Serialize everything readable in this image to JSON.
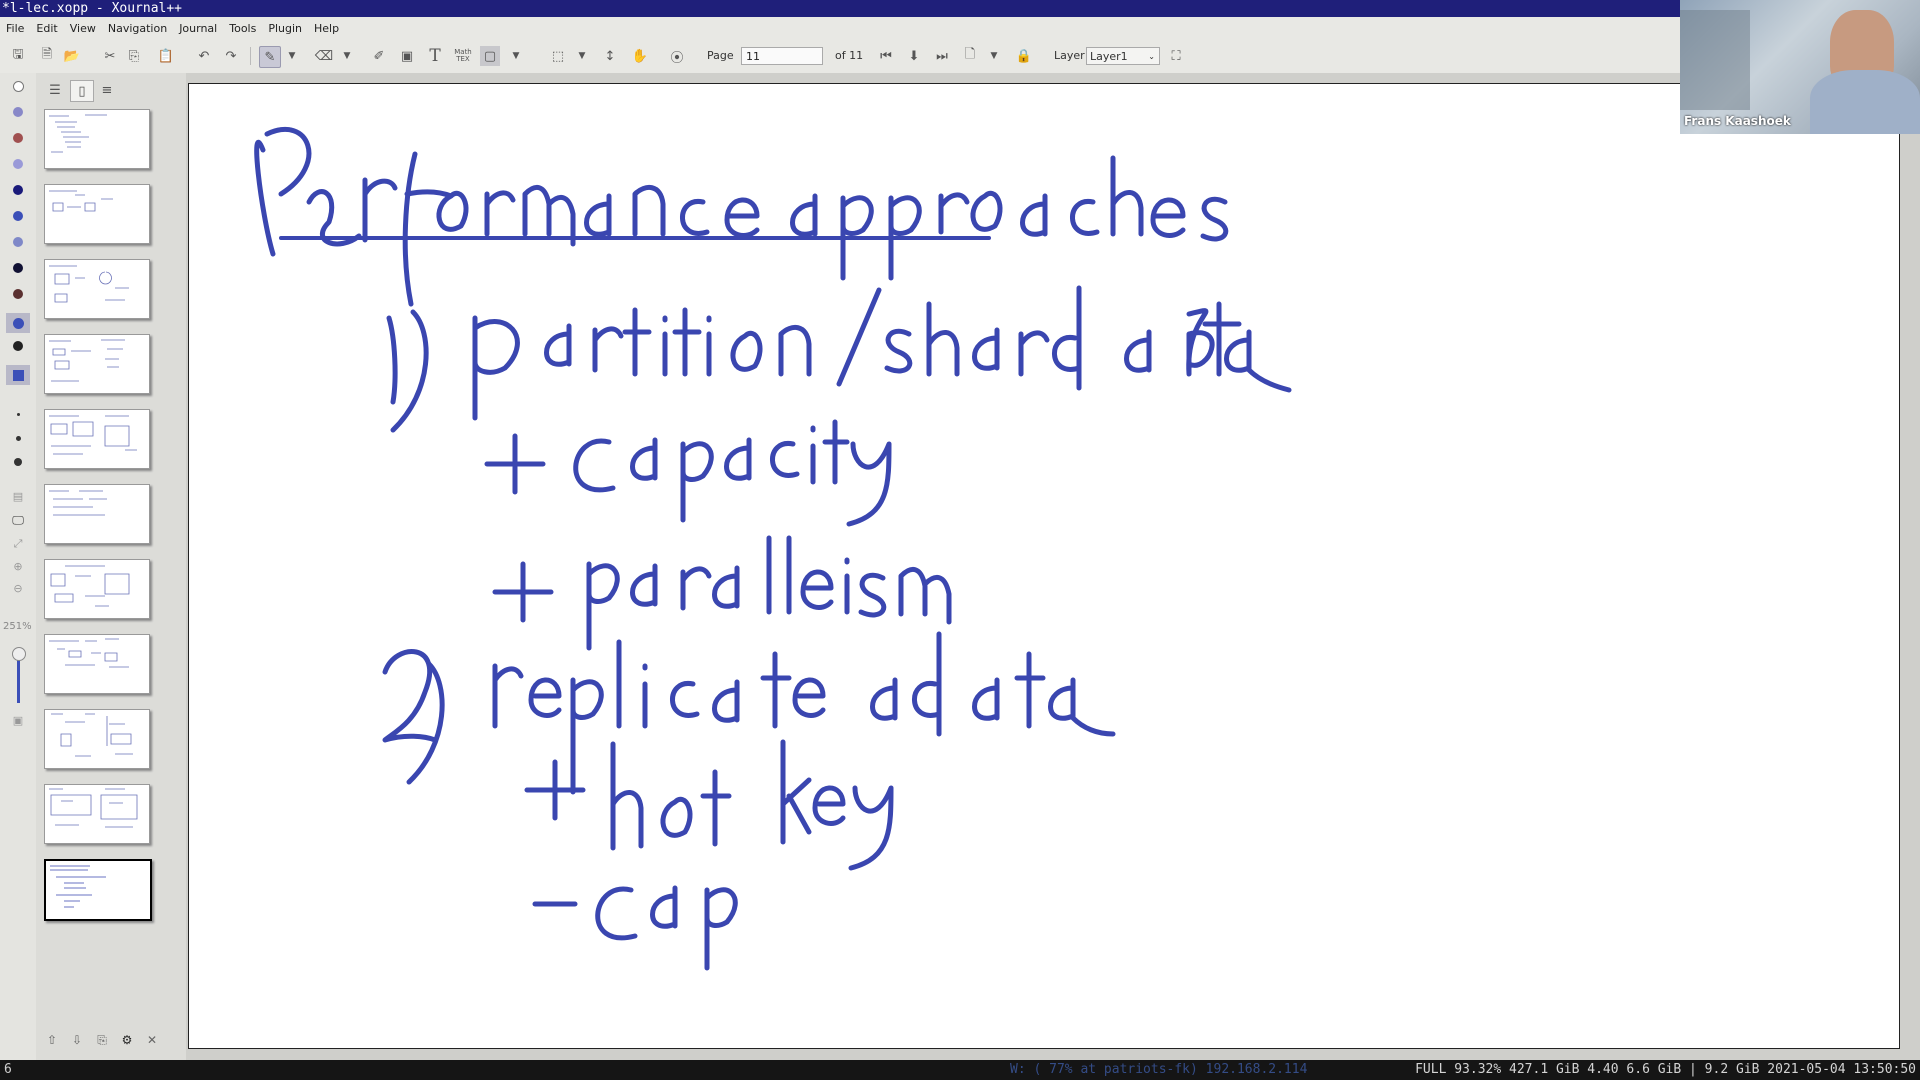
{
  "window": {
    "title": "*l-lec.xopp - Xournal++"
  },
  "menubar": {
    "items": [
      "File",
      "Edit",
      "View",
      "Navigation",
      "Journal",
      "Tools",
      "Plugin",
      "Help"
    ]
  },
  "toolbar": {
    "page_label": "Page",
    "page_value": "11",
    "page_of": "of 11",
    "layer_label": "Layer",
    "layer_value": "Layer1",
    "icons": [
      "save-icon",
      "new-page-icon",
      "open-icon",
      "cut-icon",
      "copy-icon",
      "paste-icon",
      "undo-icon",
      "redo-icon",
      "pen-icon",
      "eraser-icon",
      "highlighter-icon",
      "image-icon",
      "text-icon",
      "math-tex-icon",
      "select-icon",
      "hand-icon",
      "zoom-icon",
      "first-page-icon",
      "prev-page-icon",
      "next-page-icon",
      "last-page-icon",
      "fullscreen-icon"
    ]
  },
  "toolcolumn": {
    "zoom_label": "251%",
    "pen_colors": [
      "#ffffff",
      "#7777cc",
      "#a05050",
      "#9a9ad8",
      "#1a1a7a",
      "#3b4fb8",
      "#7f88c8",
      "#111133",
      "#5a3030",
      "#3b4fb8",
      "#222222",
      "#3b4fb8"
    ]
  },
  "sidebar": {
    "page_count": 11,
    "selected_page": 11,
    "thumbnails": [
      {
        "label": "Lec-overview"
      },
      {
        "label": "Memcached"
      },
      {
        "label": "Website evolution"
      },
      {
        "label": "Web servers"
      },
      {
        "label": "Facebook's architecture"
      },
      {
        "label": "Consistency overview"
      },
      {
        "label": "Invalidation of cache"
      },
      {
        "label": "Regions"
      },
      {
        "label": "Lease"
      },
      {
        "label": "Regions"
      },
      {
        "label": "Performance approaches"
      }
    ]
  },
  "canvas": {
    "ink_color": "#3a46b0",
    "handwriting": {
      "title": "Performance approaches",
      "item1": "1) partition / shard data",
      "item1_plus1": "+ capacity",
      "item1_plus2": "+ parallelism",
      "item2": "2) replicate data",
      "item2_plus1": "+ hot key",
      "item2_minus1": "- cap"
    }
  },
  "webcam": {
    "name": "Frans Kaashoek"
  },
  "statusbar": {
    "left": "6",
    "network": "W: ( 77% at patriots-fk) 192.168.2.114",
    "right": "FULL 93.32% 427.1 GiB 4.40 6.6 GiB | 9.2 GiB 2021-05-04 13:50:50"
  }
}
